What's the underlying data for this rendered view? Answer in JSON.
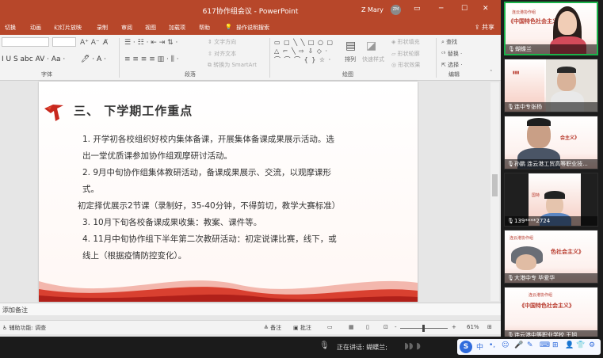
{
  "window": {
    "title": "617协作组会议 - PowerPoint",
    "user_name": "Z Mary",
    "user_initials": "ZM",
    "min_icon": "minimize-icon",
    "max_icon": "maximize-icon",
    "close_icon": "close-icon"
  },
  "ribbon_tabs": [
    "切换",
    "动画",
    "幻灯片放映",
    "录制",
    "审阅",
    "视图",
    "加载项",
    "帮助"
  ],
  "tell_me": "操作说明搜索",
  "share_label": "共享",
  "ribbon": {
    "font_group": "字体",
    "paragraph_group": "段落",
    "drawing_group": "绘图",
    "editing_group": "编辑",
    "text_direction": "文字方向",
    "align_text": "对齐文本",
    "smartart": "转换为 SmartArt",
    "arrange": "排列",
    "quick_styles": "快速样式",
    "shape_fill": "形状填充",
    "shape_outline": "形状轮廓",
    "shape_effects": "形状效果",
    "find": "查找",
    "replace": "替换",
    "select": "选择"
  },
  "slide": {
    "heading": "三、 下学期工作重点",
    "lines": [
      "1.   开学初各校组织好校内集体备课，开展集体备课成果展示活动。选",
      "出一堂优质课参加协作组观摩研讨活动。",
      "2.   9月中旬协作组集体教研活动，备课成果展示、交流，以观摩课形",
      "式。",
      "初定择优展示2节课（录制好，35-40分钟，不得剪切，教学大赛标准）",
      "3.   10月下旬各校备课成果收集：教案、课件等。",
      "4.   11月中旬协作组下半年第二次教研活动：初定说课比赛，线下，或",
      "线上（根据疫情防控变化）。"
    ]
  },
  "notes_placeholder": "添加备注",
  "status": {
    "accessibility": "辅助功能: 调查",
    "notes_btn": "备注",
    "comments_btn": "批注",
    "zoom_minus": "-",
    "zoom_plus": "+",
    "zoom_level": "61%"
  },
  "meeting": {
    "speaking": "正在讲话: 蝴蝶兰;"
  },
  "ime": {
    "logo": "S",
    "mode": "中"
  },
  "participants": [
    {
      "name": "蝴蝶兰",
      "active": true
    },
    {
      "name": "连中专张杨",
      "active": false
    },
    {
      "name": "孙鹏 连云港工贸高等职业技...",
      "active": false
    },
    {
      "name": "139****2724",
      "active": false
    },
    {
      "name": "大港中专 毕爱华",
      "active": false
    },
    {
      "name": "连云港中等职业学校 王旭",
      "active": false
    }
  ],
  "tile_slide_texts": {
    "line1": "连云港协作组",
    "line2": "《中国特色社会主义》"
  },
  "colors": {
    "ppt_red": "#b7472a",
    "slide_red": "#c8281e",
    "active_tile": "#1bb34b"
  }
}
